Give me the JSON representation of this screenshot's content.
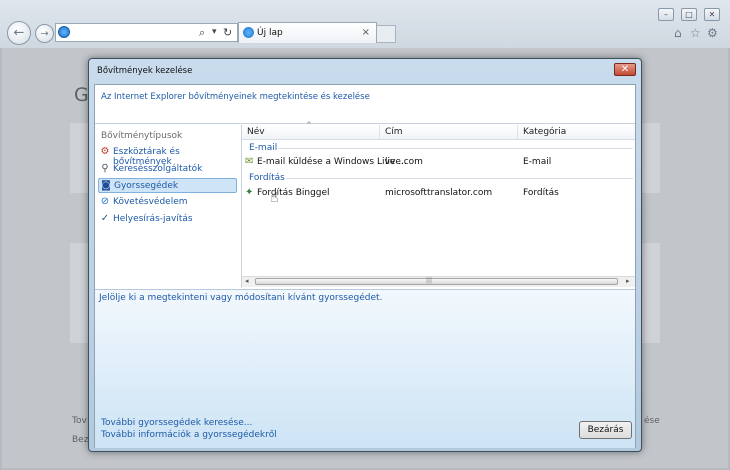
{
  "browser": {
    "tab_label": "Új lap",
    "tab_close_glyph": "×",
    "address_search_glyph": "⌕",
    "address_dropdown_glyph": "▾",
    "address_refresh_glyph": "↻",
    "window_controls": {
      "minimize": "–",
      "maximize": "□",
      "close": "✕"
    },
    "toolbar_icons": {
      "home": "⌂",
      "favorites": "☆",
      "tools": "⚙"
    },
    "nav": {
      "back_glyph": "←",
      "forward_glyph": "→"
    },
    "background_text": {
      "heading_initial": "Gy",
      "left_text": "Tov",
      "left_text_2": "Bez",
      "right_text": "ése"
    }
  },
  "dialog": {
    "title": "Bővítmények kezelése",
    "close_glyph": "✕",
    "header_text": "Az Internet Explorer bővítményeinek megtekintése és kezelése",
    "addon_types_heading": "Bővítménytípusok",
    "addon_types": [
      {
        "label": "Eszköztárak és bővítmények",
        "icon": "gear-icon",
        "glyph": "⚙",
        "color": "#c0392b",
        "selected": false
      },
      {
        "label": "Keresésszolgáltatók",
        "icon": "search-icon",
        "glyph": "⚲",
        "color": "#4a5a6a",
        "selected": false
      },
      {
        "label": "Gyorssegédek",
        "icon": "accelerator-icon",
        "glyph": "◙",
        "color": "#1f4f9a",
        "selected": true
      },
      {
        "label": "Követésvédelem",
        "icon": "tracking-protection-icon",
        "glyph": "⊘",
        "color": "#1e6fc6",
        "selected": false
      },
      {
        "label": "Helyesírás-javítás",
        "icon": "spelling-icon",
        "glyph": "✓",
        "color": "#2b5a9a",
        "selected": false
      }
    ],
    "columns": [
      "Név",
      "Cím",
      "Kategória"
    ],
    "sort_glyph": "^",
    "groups": [
      {
        "name": "E-mail",
        "rows": [
          {
            "name": "E-mail küldése a Windows Live ...",
            "address": "live.com",
            "category": "E-mail",
            "icon_glyph": "✉"
          }
        ]
      },
      {
        "name": "Fordítás",
        "rows": [
          {
            "name": "Fordítás Binggel",
            "address": "microsofttranslator.com",
            "category": "Fordítás",
            "icon_glyph": "✦"
          }
        ]
      }
    ],
    "scroll": {
      "left_glyph": "◂",
      "right_glyph": "▸",
      "grip_glyph": "|||"
    },
    "hint": "Jelölje ki a megtekinteni vagy módosítani kívánt gyorssegédet.",
    "footer_links": [
      "További gyorssegédek keresése...",
      "További információk a gyorssegédekről"
    ],
    "close_button": "Bezárás"
  },
  "cursor_glyph": "☝"
}
